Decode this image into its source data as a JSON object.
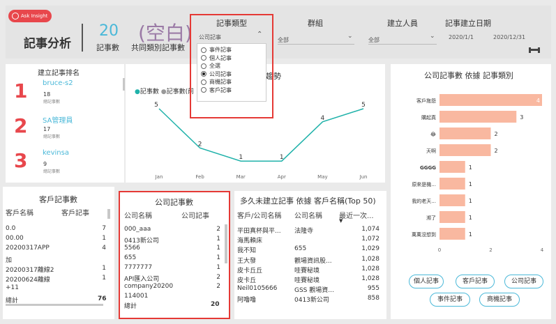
{
  "header": {
    "ask_label": "Ask Insight",
    "title": "記事分析",
    "kpi1": {
      "value": "20",
      "label": "記事數"
    },
    "kpi2": {
      "value": "(空白)",
      "label": "共同類別記事數"
    }
  },
  "slicers": {
    "type": {
      "label": "記事類型",
      "selected": "公司記事",
      "options": [
        "事件記事",
        "個人記事",
        "全選",
        "公司記事",
        "商機記事",
        "客戶記事"
      ],
      "checked_index": 3
    },
    "group": {
      "label": "群組",
      "selected": "全部"
    },
    "creator": {
      "label": "建立人員",
      "selected": "全部"
    },
    "date": {
      "label": "記事建立日期",
      "start": "2020/1/1",
      "end": "2020/12/31"
    }
  },
  "ranking": {
    "title": "建立記事排名",
    "items": [
      {
        "rank": "1",
        "name": "bruce-s2",
        "count": "18",
        "sub": "總記事數"
      },
      {
        "rank": "2",
        "name": "SA管理員",
        "count": "17",
        "sub": "總記事數"
      },
      {
        "rank": "3",
        "name": "kevinsa",
        "count": "9",
        "sub": "總記事數"
      }
    ]
  },
  "linechart": {
    "title_tail": "七趨勢",
    "legend": [
      "記事數",
      "記事數(前"
    ],
    "months": [
      "Jan",
      "Feb",
      "Mar",
      "Apr",
      "May",
      "Jun"
    ],
    "values": [
      5,
      2,
      1,
      1,
      4,
      5
    ]
  },
  "barchart": {
    "title": "公司記事數 依據 記事類別",
    "categories": [
      "客戶拖怨",
      "購起真",
      "😂",
      "天啊",
      "GGGG",
      "原來是機...",
      "我的老天...",
      "瀕了",
      "萬萬沒想到"
    ],
    "values": [
      4,
      3,
      2,
      2,
      1,
      1,
      1,
      1,
      1
    ],
    "axis_ticks": [
      "0",
      "2",
      "4"
    ],
    "xmax": 4
  },
  "chart_data": {
    "type": "bar",
    "categories": [
      "客戶拖怨",
      "購起真",
      "😂",
      "天啊",
      "GGGG",
      "原來是機...",
      "我的老天...",
      "瀕了",
      "萬萬沒想到"
    ],
    "values": [
      4,
      3,
      2,
      2,
      1,
      1,
      1,
      1,
      1
    ],
    "title": "公司記事數 依據 記事類別",
    "xlim": [
      0,
      4
    ]
  },
  "filters": [
    "個人記事",
    "客戶記事",
    "公司記事",
    "事件記事",
    "商機記事"
  ],
  "customer_table": {
    "title": "客戶記事數",
    "headers": [
      "客戶名稱",
      "客戶記事"
    ],
    "rows": [
      [
        "0.0",
        "7"
      ],
      [
        "00.00",
        "1"
      ],
      [
        "20200317APP",
        "4"
      ],
      [
        "加",
        ""
      ],
      [
        "20200317離線2",
        "1"
      ],
      [
        "20200624離線",
        "1"
      ],
      [
        "+11",
        ""
      ]
    ],
    "total_label": "總計",
    "total": "76"
  },
  "company_table": {
    "title": "公司記事數",
    "headers": [
      "公司名稱",
      "公司記事"
    ],
    "rows": [
      [
        "000_aaa",
        "2"
      ],
      [
        "0413新公司",
        "1"
      ],
      [
        "5566",
        "1"
      ],
      [
        "655",
        "1"
      ],
      [
        "7777777",
        "1"
      ],
      [
        "API匯入公司",
        "2"
      ],
      [
        "company20200",
        "2"
      ],
      [
        "114001",
        ""
      ]
    ],
    "total_label": "總計",
    "total": "20"
  },
  "longest_table": {
    "title": "多久未建立記事 依據 客戶名稱(Top 50)",
    "headers": [
      "客戶/公司名稱",
      "公司名稱",
      "最近一次..."
    ],
    "rows": [
      [
        "平田真杯與平...",
        "法隆寺",
        "1,074"
      ],
      [
        "海馬賴床",
        "",
        "1,072"
      ],
      [
        "我不知",
        "655",
        "1,029"
      ],
      [
        "王大發",
        "觀場資訊股...",
        "1,028"
      ],
      [
        "皮卡丘丘",
        "哇賽秘境",
        "1,028"
      ],
      [
        "皮卡丘",
        "哇賽秘境",
        "1,028"
      ],
      [
        "Neil0105666",
        "GSS 觀場資...",
        "955"
      ],
      [
        "阿噜噜",
        "0413新公司",
        "858"
      ]
    ]
  }
}
